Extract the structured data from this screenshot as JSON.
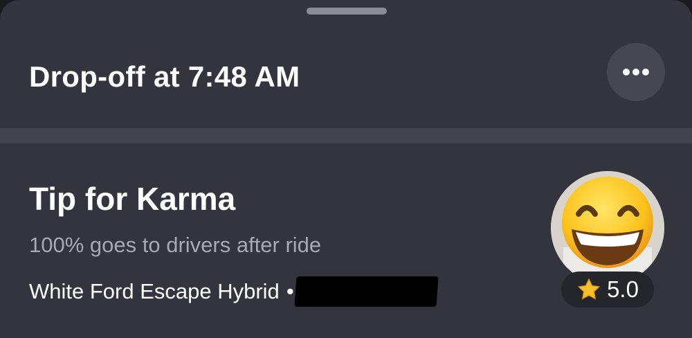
{
  "header": {
    "title": "Drop-off at 7:48 AM",
    "more_icon": "more-horizontal-icon"
  },
  "tip": {
    "title": "Tip for Karma",
    "subtitle": "100% goes to drivers after ride"
  },
  "vehicle": {
    "description": "White Ford Escape Hybrid",
    "separator": "•"
  },
  "driver": {
    "avatar_icon": "grinning-face-emoji",
    "rating": "5.0",
    "rating_icon": "star-icon"
  },
  "colors": {
    "sheet_background": "#34343f",
    "divider": "#43434d",
    "primary_text": "#ffffff",
    "secondary_text": "#a9a9b2",
    "rating_badge": "#25252c",
    "star": "#f5c02a"
  }
}
